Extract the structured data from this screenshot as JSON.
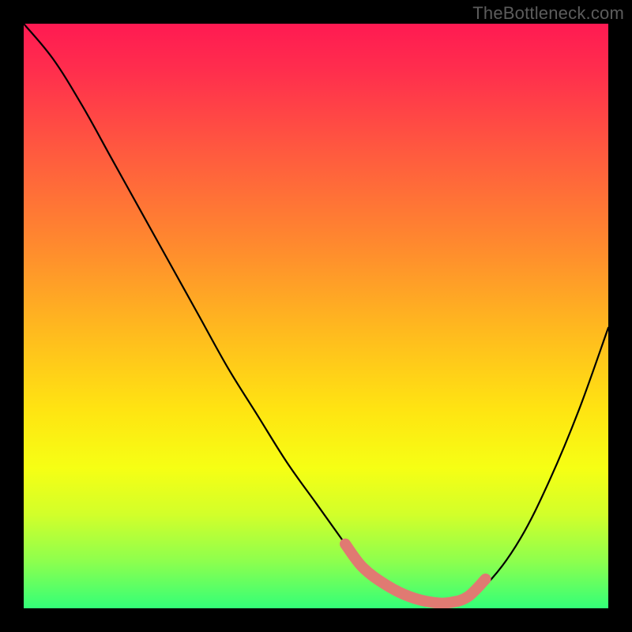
{
  "watermark": "TheBottleneck.com",
  "chart_data": {
    "type": "line",
    "title": "",
    "xlabel": "",
    "ylabel": "",
    "xlim": [
      0,
      100
    ],
    "ylim": [
      0,
      100
    ],
    "grid": false,
    "series": [
      {
        "name": "curve",
        "color": "#000000",
        "x": [
          0,
          5,
          10,
          15,
          20,
          25,
          30,
          35,
          40,
          45,
          50,
          55,
          58,
          62,
          66,
          70,
          73,
          76,
          80,
          85,
          90,
          95,
          100
        ],
        "y": [
          100,
          94,
          86,
          77,
          68,
          59,
          50,
          41,
          33,
          25,
          18,
          11,
          7,
          4,
          2,
          1,
          1,
          2,
          5,
          12,
          22,
          34,
          48
        ]
      },
      {
        "name": "highlight-band",
        "color": "#e07a72",
        "x": [
          55,
          58,
          62,
          66,
          70,
          73,
          76,
          79
        ],
        "y": [
          11,
          7,
          4,
          2,
          1,
          1,
          2,
          5
        ]
      }
    ],
    "gradient_stops": [
      {
        "pos": 0,
        "color": "#ff1a52"
      },
      {
        "pos": 22,
        "color": "#ff5a3f"
      },
      {
        "pos": 52,
        "color": "#ffb81f"
      },
      {
        "pos": 76,
        "color": "#f6ff14"
      },
      {
        "pos": 100,
        "color": "#33ff78"
      }
    ]
  }
}
